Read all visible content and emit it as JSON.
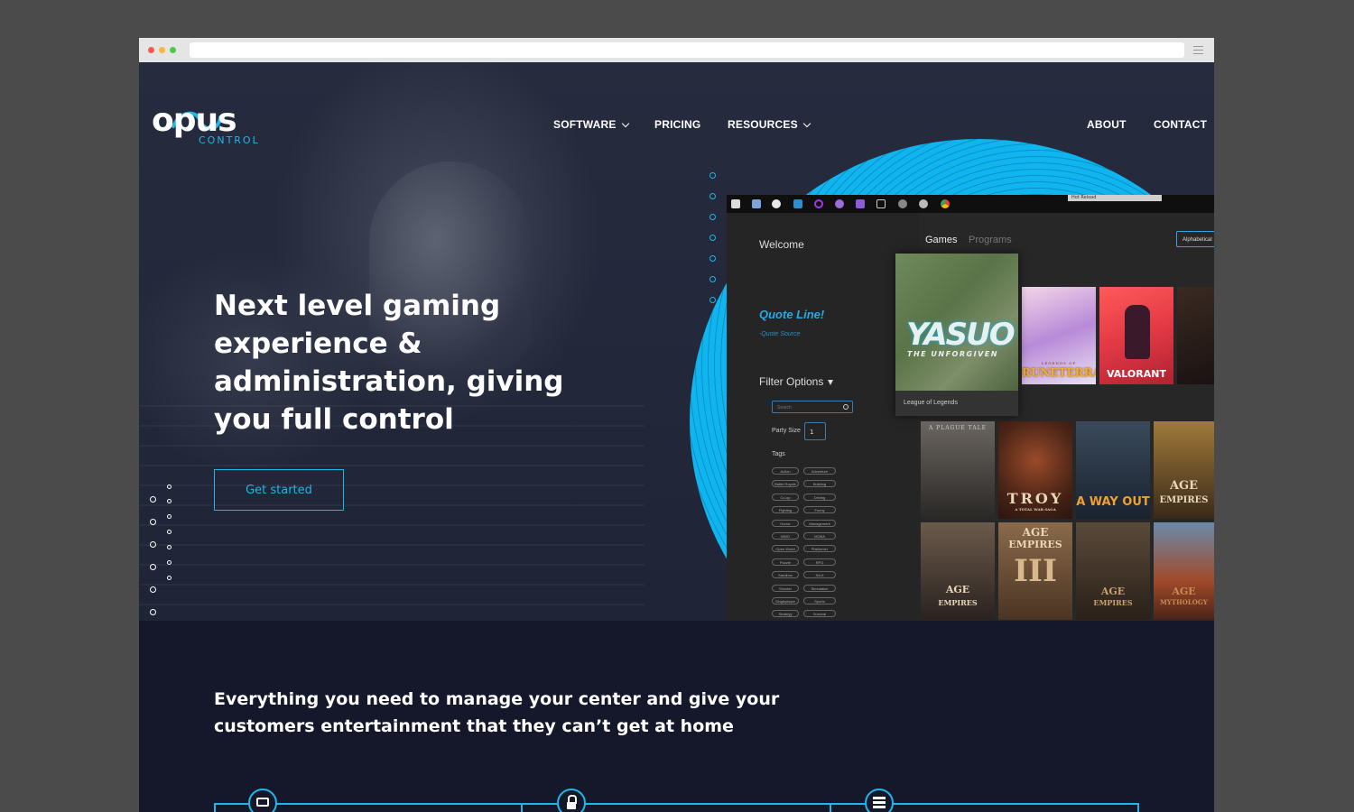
{
  "brand": {
    "logo_text": "opus",
    "logo_sub": "CONTROL",
    "accent": "#1fb6e8"
  },
  "nav": {
    "software": "SOFTWARE",
    "pricing": "PRICING",
    "resources": "RESOURCES",
    "about": "ABOUT",
    "contact": "CONTACT"
  },
  "hero": {
    "headline": "Next level gaming experience & administration, giving you full control",
    "cta": "Get started"
  },
  "app": {
    "hot_reload": "Hot Reload",
    "welcome": "Welcome",
    "quote": "Quote Line!",
    "quote_source": "-Quote Source",
    "filter_options": "Filter Options",
    "search_placeholder": "Search",
    "party_size_label": "Party Size",
    "party_size_value": "1",
    "tags_label": "Tags",
    "tags": [
      "Action",
      "Adventure",
      "Battle Royale",
      "Building",
      "Co-op",
      "Driving",
      "Fighting",
      "Funny",
      "Horror",
      "Management",
      "MMO",
      "MOBA",
      "Open World",
      "Platformer",
      "Puzzle",
      "RPG",
      "Sandbox",
      "Sci-fi",
      "Shooter",
      "Simulation",
      "Singleplayer",
      "Sports",
      "Strategy",
      "Survival"
    ],
    "tab_games": "Games",
    "tab_programs": "Programs",
    "sort": "Alphabetical",
    "featured_title": "YASUO",
    "featured_subtitle": "THE UNFORGIVEN",
    "featured_caption": "League of Legends",
    "covers": {
      "runeterra_top": "LEGENDS OF",
      "runeterra": "RUNETERRA",
      "valorant": "VALORANT",
      "plague_top": "A PLAGUE TALE",
      "troy": "TROY",
      "troy_sub": "A TOTAL WAR SAGA",
      "away_out": "A WAY OUT",
      "age": "AGE",
      "empires": "EMPIRES",
      "age2": "AGE",
      "empires2": "EMPIRES",
      "numeral": "III",
      "age3": "AGE",
      "empires3": "EMPIRES",
      "age4": "AGE",
      "mythology": "MYTHOLOGY"
    }
  },
  "section2": {
    "tagline": "Everything you need to manage your center and give your customers entertainment that they can’t get at home"
  }
}
